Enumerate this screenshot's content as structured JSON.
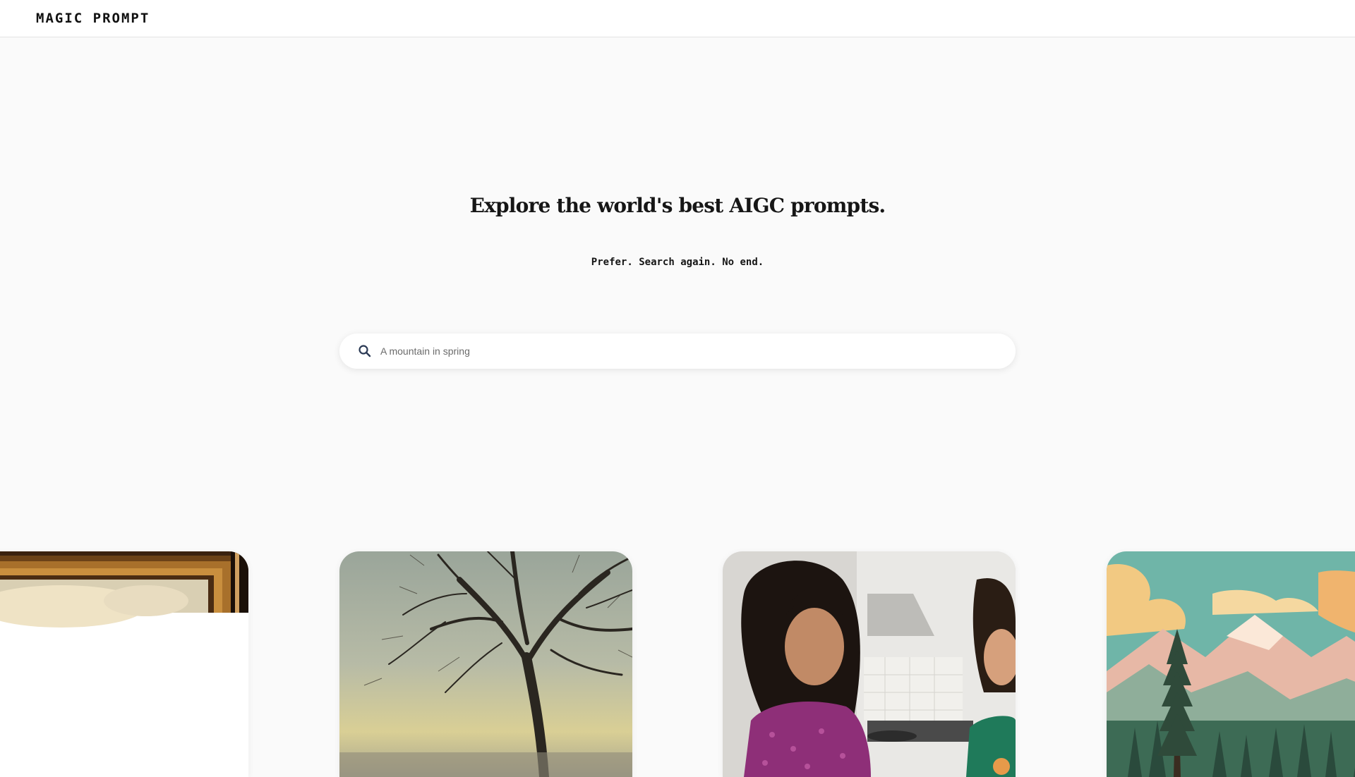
{
  "header": {
    "logo": "MAGIC PROMPT"
  },
  "hero": {
    "title": "Explore the world's best AIGC prompts.",
    "subtitle": "Prefer. Search again. No end."
  },
  "search": {
    "icon": "search-icon",
    "placeholder": "A mountain in spring"
  },
  "cards": [
    {
      "image": "framed-painting"
    },
    {
      "image": "bare-tree-painting"
    },
    {
      "image": "mother-daughter-kitchen"
    },
    {
      "image": "mountain-forest-illustration"
    }
  ],
  "colors": {
    "background": "#fafafa",
    "header_bg": "#ffffff",
    "search_icon": "#2b3a55",
    "text": "#161616"
  }
}
